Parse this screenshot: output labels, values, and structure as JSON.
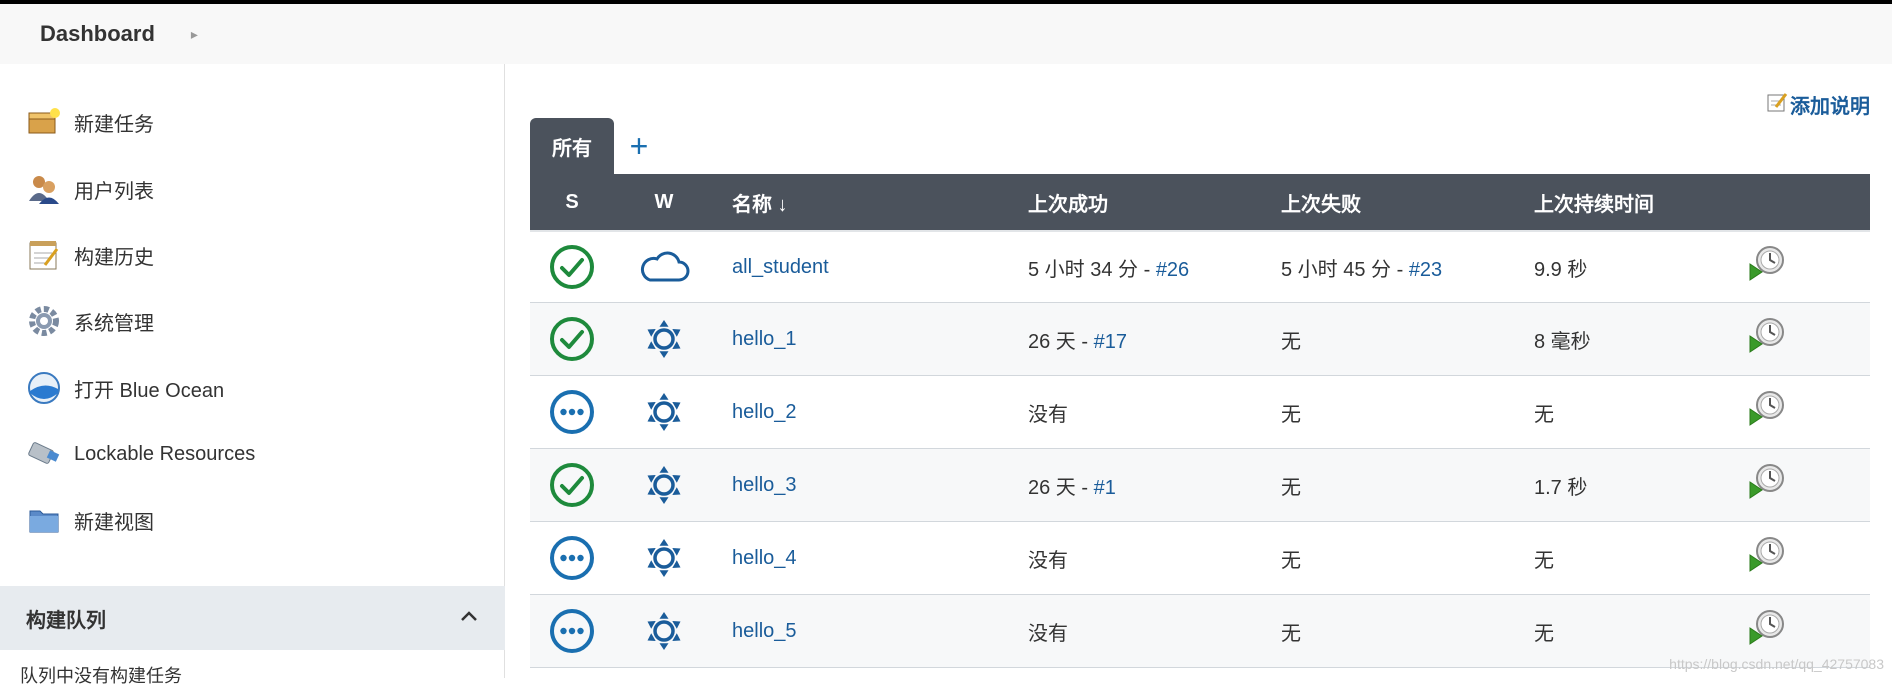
{
  "breadcrumb": {
    "root": "Dashboard"
  },
  "sidebar": {
    "items": [
      {
        "label": "新建任务",
        "icon": "new-task-icon"
      },
      {
        "label": "用户列表",
        "icon": "users-icon"
      },
      {
        "label": "构建历史",
        "icon": "notepad-icon"
      },
      {
        "label": "系统管理",
        "icon": "gear-icon"
      },
      {
        "label": "打开 Blue Ocean",
        "icon": "blue-ocean-icon"
      },
      {
        "label": "Lockable Resources",
        "icon": "usb-icon"
      },
      {
        "label": "新建视图",
        "icon": "folder-icon"
      }
    ],
    "queue": {
      "title": "构建队列",
      "empty_text": "队列中没有构建任务"
    }
  },
  "main": {
    "add_description": "添加说明",
    "tabs": {
      "active": "所有",
      "add": "+"
    },
    "columns": {
      "s": "S",
      "w": "W",
      "name": "名称 ↓",
      "last_success": "上次成功",
      "last_failure": "上次失败",
      "last_duration": "上次持续时间"
    },
    "jobs": [
      {
        "status": "success",
        "weather": "cloudy",
        "name": "all_student",
        "last_success": "5 小时 34 分 - ",
        "last_success_build": "#26",
        "last_failure": "5 小时 45 分 - ",
        "last_failure_build": "#23",
        "last_duration": "9.9 秒"
      },
      {
        "status": "success",
        "weather": "sunny",
        "name": "hello_1",
        "last_success": "26 天 - ",
        "last_success_build": "#17",
        "last_failure": "无",
        "last_failure_build": "",
        "last_duration": "8 毫秒"
      },
      {
        "status": "notbuilt",
        "weather": "sunny",
        "name": "hello_2",
        "last_success": "没有",
        "last_success_build": "",
        "last_failure": "无",
        "last_failure_build": "",
        "last_duration": "无"
      },
      {
        "status": "success",
        "weather": "sunny",
        "name": "hello_3",
        "last_success": "26 天 - ",
        "last_success_build": "#1",
        "last_failure": "无",
        "last_failure_build": "",
        "last_duration": "1.7 秒"
      },
      {
        "status": "notbuilt",
        "weather": "sunny",
        "name": "hello_4",
        "last_success": "没有",
        "last_success_build": "",
        "last_failure": "无",
        "last_failure_build": "",
        "last_duration": "无"
      },
      {
        "status": "notbuilt",
        "weather": "sunny",
        "name": "hello_5",
        "last_success": "没有",
        "last_success_build": "",
        "last_failure": "无",
        "last_failure_build": "",
        "last_duration": "无"
      }
    ]
  },
  "watermark": "https://blog.csdn.net/qq_42757083",
  "colors": {
    "success": "#1e8a3c",
    "notbuilt": "#1a6fb0",
    "header_bg": "#4b525c",
    "link": "#1a5c9a"
  }
}
